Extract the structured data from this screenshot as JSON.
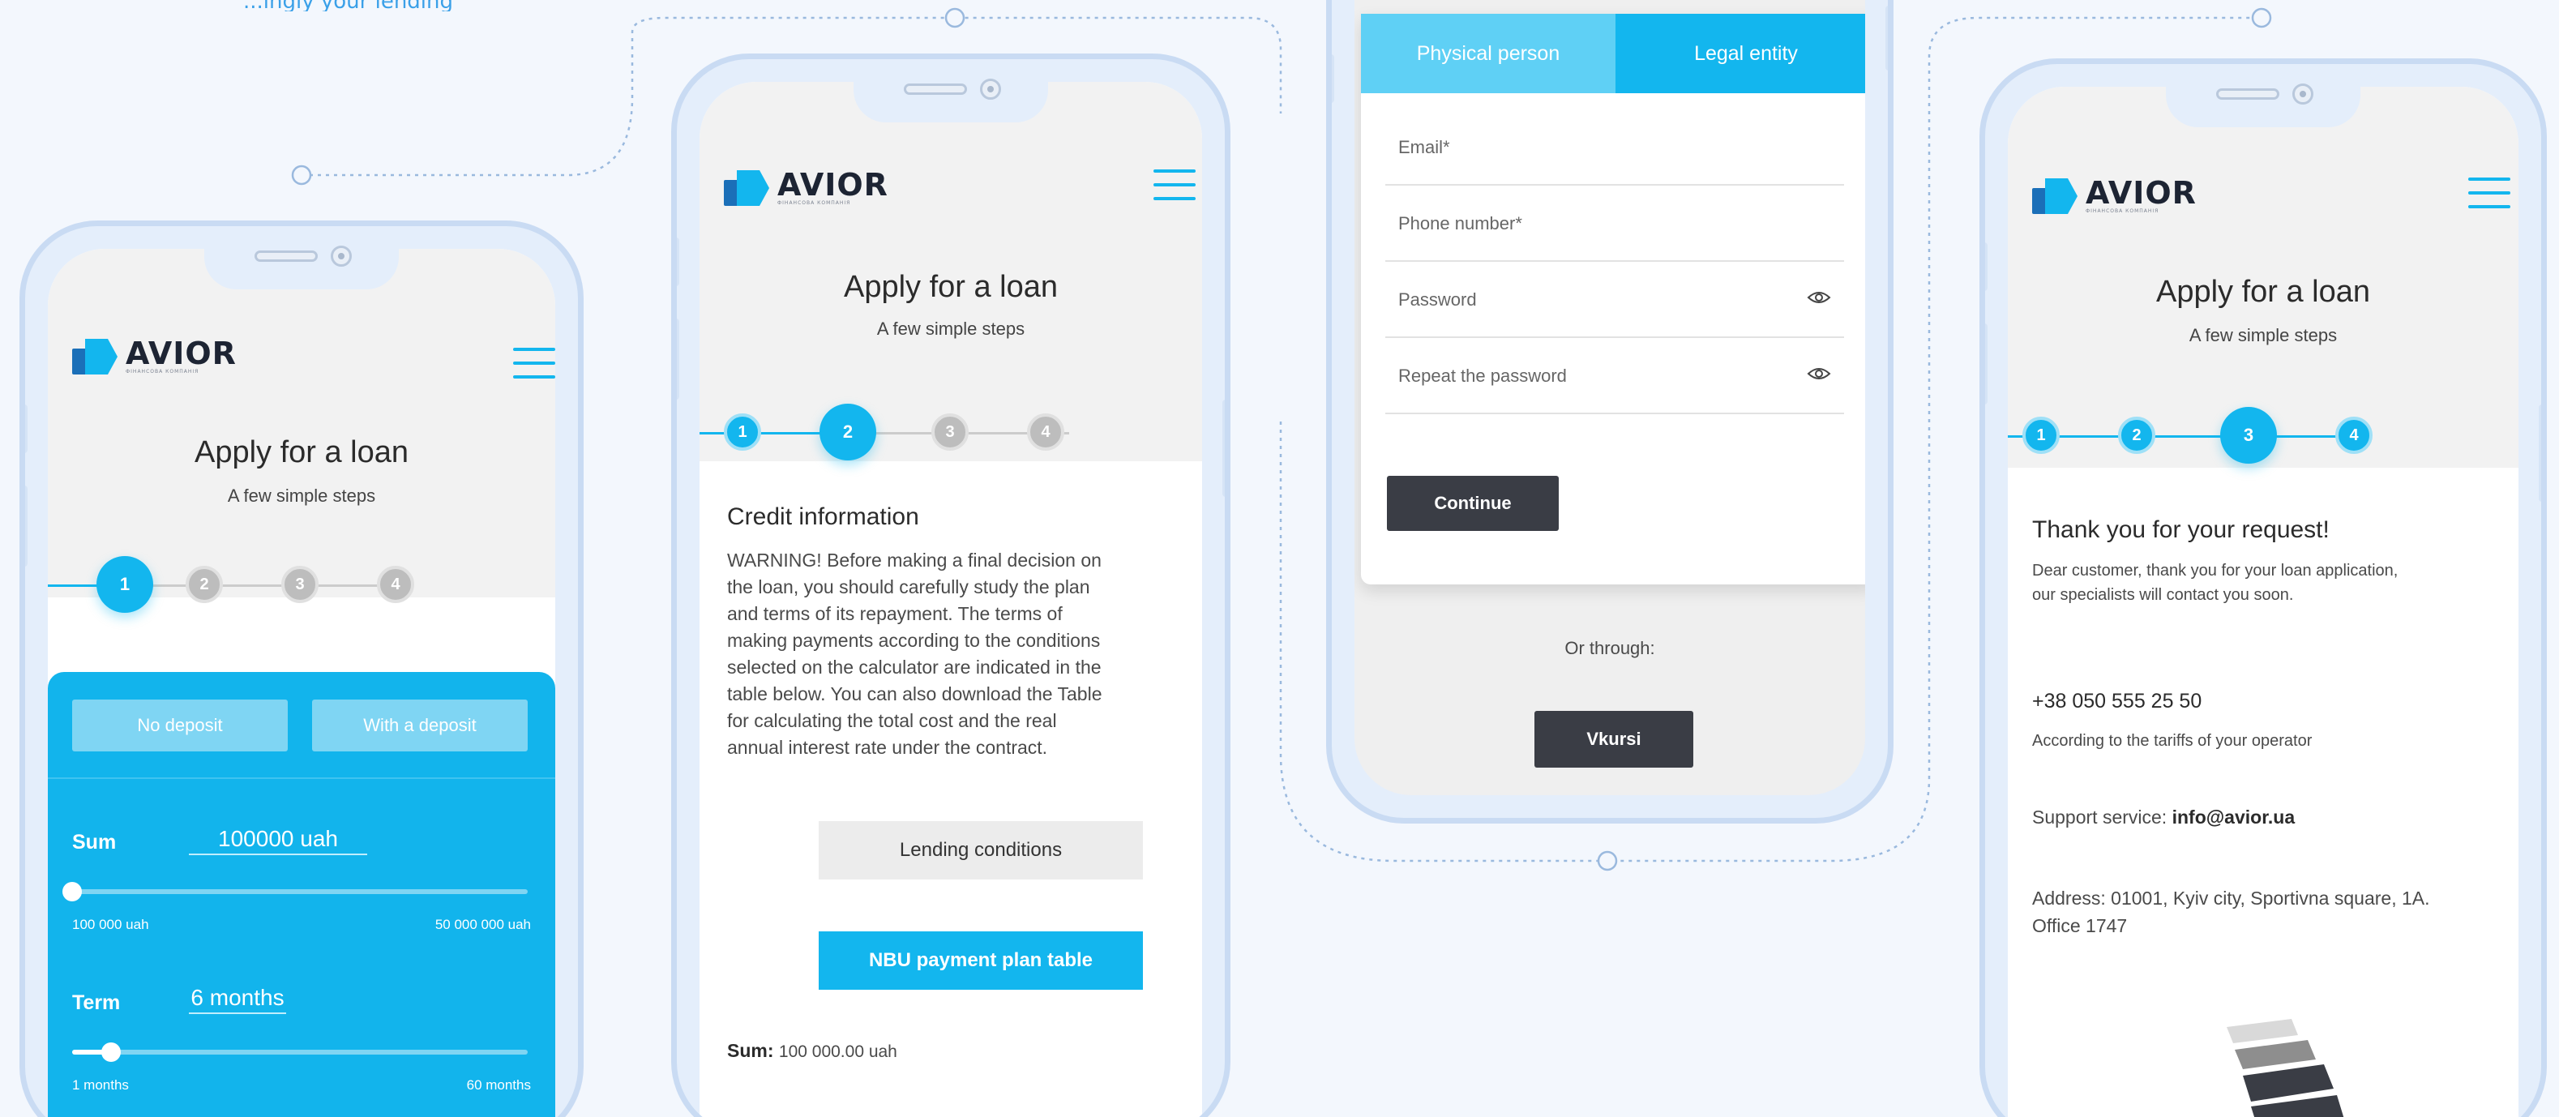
{
  "colors": {
    "accent": "#13b6ee",
    "dark_button": "#3a3d45",
    "background": "#f3f7fd"
  },
  "brand": {
    "name": "AVIOR",
    "tagline": "ФІНАНСОВА КОМПАНІЯ"
  },
  "icons": {
    "logo": "avior-logo-icon",
    "menu": "hamburger-menu-icon",
    "password_toggle": "eye-icon"
  },
  "header": {
    "title": "Apply for a loan",
    "subtitle": "A few simple steps",
    "steps": [
      "1",
      "2",
      "3",
      "4"
    ]
  },
  "top_note": "...ingly your lending",
  "screen1": {
    "active_step": 1,
    "deposit_tabs": [
      "No deposit",
      "With a deposit"
    ],
    "sum_label": "Sum",
    "sum_value": "100000 uah",
    "sum_min": "100 000 uah",
    "sum_max": "50 000 000 uah",
    "sum_level": 0,
    "term_label": "Term",
    "term_value": "6 months",
    "term_min": "1 months",
    "term_max": "60 months",
    "term_level": 0.085
  },
  "screen2": {
    "active_step": 2,
    "section_title": "Credit information",
    "warning_lines": [
      "WARNING! Before making a final decision on",
      "the loan, you should carefully study the plan",
      "and terms of its repayment. The terms of",
      "making payments according to the conditions",
      "selected on the calculator are indicated in the",
      "table below. You can also download the Table",
      "for calculating the total cost and the real",
      "annual interest rate under the contract."
    ],
    "lending_button": "Lending conditions",
    "nbu_button": "NBU payment plan table",
    "sum_label": "Sum:",
    "sum_value": "100 000.00 uah"
  },
  "screen3": {
    "segments": [
      "Physical person",
      "Legal entity"
    ],
    "fields": [
      {
        "placeholder": "Email*",
        "has_eye": false
      },
      {
        "placeholder": "Phone number*",
        "has_eye": false
      },
      {
        "placeholder": "Password",
        "has_eye": true
      },
      {
        "placeholder": "Repeat the password",
        "has_eye": true
      }
    ],
    "continue_button": "Continue",
    "or_through": "Or through:",
    "vkursi_button": "Vkursi"
  },
  "screen4": {
    "active_step": 3,
    "thanks_title": "Thank you for your request!",
    "thanks_lines": [
      "Dear customer, thank you for your loan application,",
      "our specialists will contact you soon."
    ],
    "phone": "+38 050 555 25 50",
    "phone_note": "According to the tariffs of your operator",
    "support_label": "Support service: ",
    "support_email": "info@avior.ua",
    "address_line1": "Address: 01001, Kyiv city, Sportivna square, 1A.",
    "address_line2": "Office 1747"
  }
}
